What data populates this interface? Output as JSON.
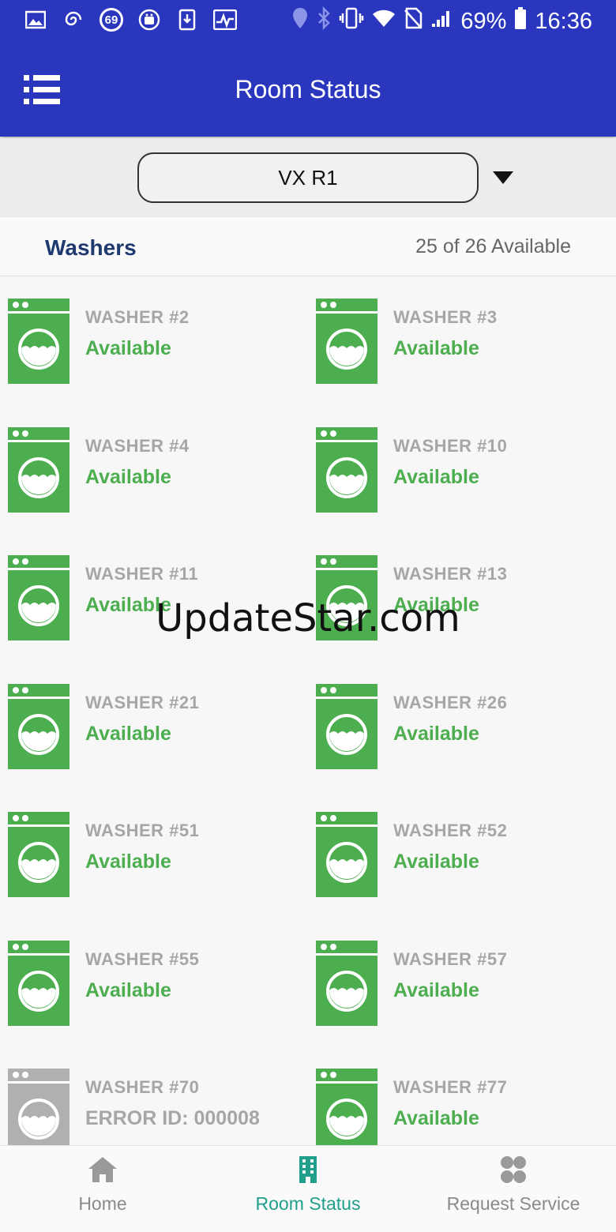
{
  "status_bar": {
    "badge_number": "69",
    "battery": "69%",
    "time": "16:36"
  },
  "app_bar": {
    "title": "Room Status",
    "menu_icon": "hamburger-menu-icon"
  },
  "room_selector": {
    "selected": "VX R1"
  },
  "section": {
    "title": "Washers",
    "count": "25 of 26 Available"
  },
  "machines": [
    {
      "name": "WASHER #2",
      "status": "Available",
      "state": "available"
    },
    {
      "name": "WASHER #3",
      "status": "Available",
      "state": "available"
    },
    {
      "name": "WASHER #4",
      "status": "Available",
      "state": "available"
    },
    {
      "name": "WASHER #10",
      "status": "Available",
      "state": "available"
    },
    {
      "name": "WASHER #11",
      "status": "Available",
      "state": "available"
    },
    {
      "name": "WASHER #13",
      "status": "Available",
      "state": "available"
    },
    {
      "name": "WASHER #21",
      "status": "Available",
      "state": "available"
    },
    {
      "name": "WASHER #26",
      "status": "Available",
      "state": "available"
    },
    {
      "name": "WASHER #51",
      "status": "Available",
      "state": "available"
    },
    {
      "name": "WASHER #52",
      "status": "Available",
      "state": "available"
    },
    {
      "name": "WASHER #55",
      "status": "Available",
      "state": "available"
    },
    {
      "name": "WASHER #57",
      "status": "Available",
      "state": "available"
    },
    {
      "name": "WASHER #70",
      "status": "ERROR ID: 000008",
      "state": "error"
    },
    {
      "name": "WASHER #77",
      "status": "Available",
      "state": "available"
    }
  ],
  "watermark": "UpdateStar.com",
  "bottom_nav": [
    {
      "label": "Home",
      "icon": "home-icon",
      "active": false
    },
    {
      "label": "Room Status",
      "icon": "building-icon",
      "active": true
    },
    {
      "label": "Request Service",
      "icon": "grid-four-icon",
      "active": false
    }
  ],
  "colors": {
    "primary": "#2a36be",
    "available": "#4cae4f",
    "error": "#b0b0b0",
    "nav_active": "#20a08a"
  }
}
